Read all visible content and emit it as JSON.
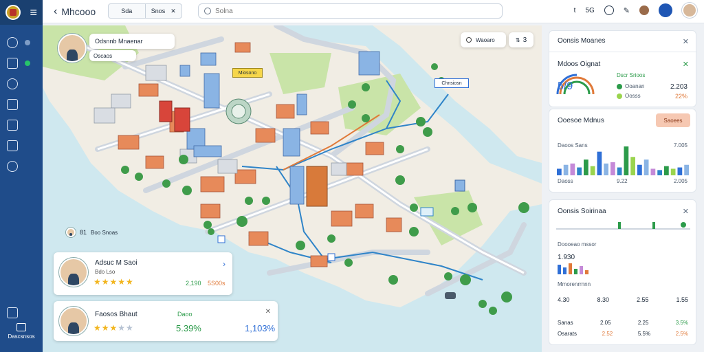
{
  "sidebar": {
    "items": [
      {
        "icon": "dashboard-icon",
        "badge": "gray"
      },
      {
        "icon": "map-icon",
        "badge": "green"
      },
      {
        "icon": "route-icon"
      },
      {
        "icon": "building-icon"
      },
      {
        "icon": "document-icon"
      },
      {
        "icon": "layers-icon"
      },
      {
        "icon": "globe-icon"
      }
    ],
    "bottom_label": "Dascsnsos"
  },
  "topbar": {
    "title": "Mhcooo",
    "segments": [
      "Sda",
      "Snos"
    ],
    "search_placeholder": "Solna",
    "right_text_1": "t",
    "right_text_2": "5G"
  },
  "map": {
    "profile_label": "Odsnnb Mnaenar",
    "profile_sub": "Oscaos",
    "tag_label": "Miosono",
    "tag2_label": "Chnsiosn",
    "top_right_text": "Waoaro",
    "top_right_num": "3",
    "mini_label": "Boo Snoas",
    "mini_num": "81"
  },
  "cards": [
    {
      "name": "Adsuc M Saoi",
      "sub": "Bdo Lso",
      "rating": 5,
      "stat_a": "2,190",
      "stat_b": "5S00s"
    },
    {
      "name": "Faosos Bhaut",
      "rating": 3,
      "stat_label": "Daoo",
      "stat_a": "5.39%",
      "stat_b": "1,103%"
    }
  ],
  "panels": {
    "p1": {
      "title": "Oonsis Moanes",
      "sub_title": "Mdoos Oignat",
      "gauge_value": "5/9",
      "legend": [
        {
          "label": "Dscr Srioos",
          "color": "#2c9b4a"
        },
        {
          "label": "Ooanan",
          "color": "#2c9b4a",
          "value": "2.203"
        },
        {
          "label": "Oosss",
          "color": "#9ad44e",
          "value": "22%"
        }
      ]
    },
    "p2": {
      "title": "Ooesoe Mdnus",
      "button": "Saoees",
      "top_left": "Daoos Sans",
      "top_right": "7.005",
      "bottom_labels": [
        "Daoss",
        "9.22",
        "2.005"
      ]
    },
    "p3": {
      "title": "Oonsis Soirinaa",
      "row1": "Doooeao mssor",
      "row1_value": "1.930",
      "row2": "Mmorenrrnnn",
      "row3_values": [
        "4.30",
        "8.30",
        "2.55",
        "1.55"
      ],
      "row4_values": [
        "Sanas",
        "2.05",
        "2.25",
        "3.5%"
      ],
      "row5_values": [
        "Osarats",
        "2.52",
        "5.5%",
        "2.5%"
      ]
    }
  },
  "chart_data": {
    "type": "bar",
    "values": [
      5,
      8,
      9,
      6,
      12,
      7,
      18,
      9,
      10,
      6,
      22,
      14,
      8,
      12,
      5,
      4,
      7,
      5,
      6,
      8
    ]
  },
  "colors": {
    "sidebar": "#1f4c8a",
    "accent": "#2f6fd6",
    "green": "#2c9b4a",
    "orange": "#e07a3a",
    "button_bg": "#f6c8b2"
  }
}
